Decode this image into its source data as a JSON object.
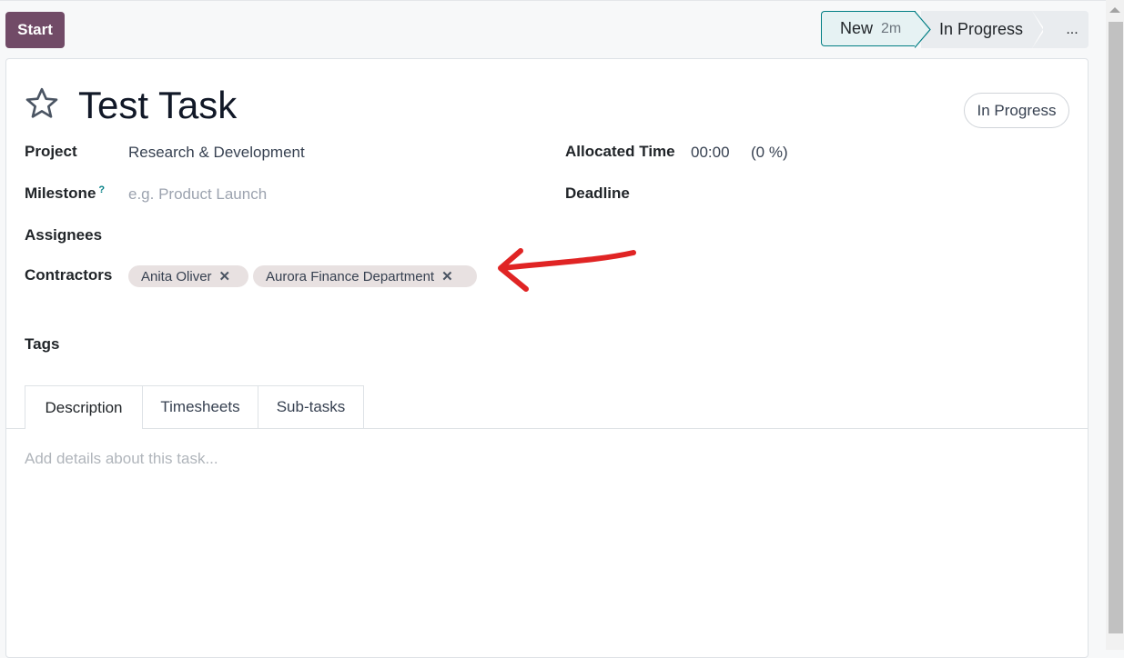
{
  "header": {
    "start_label": "Start"
  },
  "statusbar": {
    "stages": [
      {
        "label": "New",
        "duration": "2m",
        "active": true
      },
      {
        "label": "In Progress",
        "active": false
      }
    ],
    "more_label": "..."
  },
  "task": {
    "title": "Test Task",
    "state_label": "In Progress",
    "fields": {
      "project_label": "Project",
      "project_value": "Research & Development",
      "milestone_label": "Milestone",
      "milestone_help": "?",
      "milestone_placeholder": "e.g. Product Launch",
      "assignees_label": "Assignees",
      "contractors_label": "Contractors",
      "contractors": [
        "Anita Oliver",
        "Aurora Finance Department"
      ],
      "tags_label": "Tags",
      "allocated_time_label": "Allocated Time",
      "allocated_time_value": "00:00",
      "allocated_time_percent": "(0 %)",
      "deadline_label": "Deadline"
    }
  },
  "tabs": [
    {
      "label": "Description",
      "active": true
    },
    {
      "label": "Timesheets",
      "active": false
    },
    {
      "label": "Sub-tasks",
      "active": false
    }
  ],
  "description": {
    "placeholder": "Add details about this task..."
  },
  "icons": {
    "favorite": "star-outline-icon",
    "remove_tag": "close-icon",
    "annotation": "red-arrow-annotation"
  },
  "colors": {
    "primary": "#714b67",
    "accent": "#017e84",
    "annotation": "#e02424"
  }
}
